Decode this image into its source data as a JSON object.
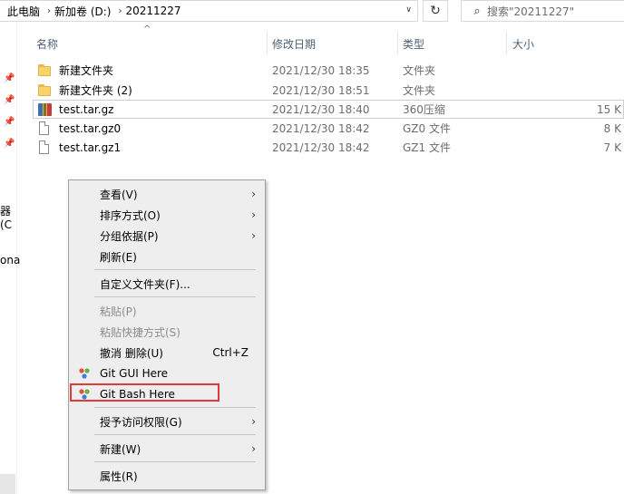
{
  "address": {
    "crumbs": [
      "此电脑",
      "新加卷 (D:)",
      "20211227"
    ],
    "sep": "›",
    "dropdown": "∨",
    "refresh": "↻"
  },
  "search": {
    "placeholder": "搜索\"20211227\""
  },
  "nav": {
    "frag1": "器 (C",
    "frag2": "ona"
  },
  "columns": {
    "name": "名称",
    "date": "修改日期",
    "type": "类型",
    "size": "大小",
    "sort_caret": "^"
  },
  "files": [
    {
      "name": "新建文件夹",
      "date": "2021/12/30 18:35",
      "type": "文件夹",
      "size": "",
      "icon": "folder-icon"
    },
    {
      "name": "新建文件夹 (2)",
      "date": "2021/12/30 18:51",
      "type": "文件夹",
      "size": "",
      "icon": "folder-icon"
    },
    {
      "name": "test.tar.gz",
      "date": "2021/12/30 18:40",
      "type": "360压缩",
      "size": "15 K",
      "icon": "archive-icon"
    },
    {
      "name": "test.tar.gz0",
      "date": "2021/12/30 18:42",
      "type": "GZ0 文件",
      "size": "8 K",
      "icon": "file-icon"
    },
    {
      "name": "test.tar.gz1",
      "date": "2021/12/30 18:42",
      "type": "GZ1 文件",
      "size": "7 K",
      "icon": "file-icon"
    }
  ],
  "menu": {
    "view": "查看(V)",
    "sort": "排序方式(O)",
    "group": "分组依据(P)",
    "refresh": "刷新(E)",
    "customize": "自定义文件夹(F)...",
    "paste": "粘贴(P)",
    "paste_shortcut": "粘贴快捷方式(S)",
    "undo": "撤消 删除(U)",
    "undo_key": "Ctrl+Z",
    "git_gui": "Git GUI Here",
    "git_bash": "Git Bash Here",
    "grant_access": "授予访问权限(G)",
    "new": "新建(W)",
    "properties": "属性(R)",
    "submenu_arrow": "›"
  },
  "colors": {
    "highlight_border": "#e0393e",
    "menu_bg": "#eeeeee",
    "header_text": "#4c607a"
  }
}
